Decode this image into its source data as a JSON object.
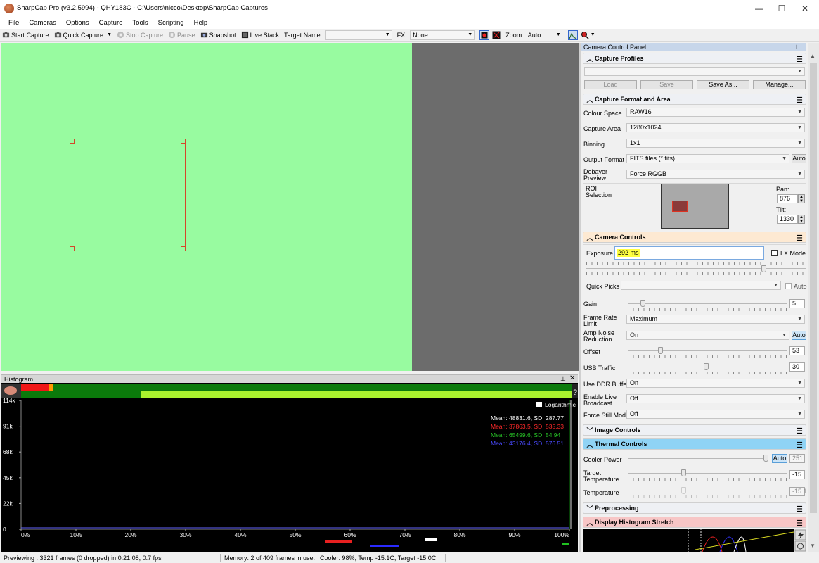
{
  "window": {
    "title": "SharpCap Pro (v3.2.5994) - QHY183C - C:\\Users\\nicco\\Desktop\\SharpCap Captures",
    "minimize": "—",
    "maximize": "☐",
    "close": "✕"
  },
  "menu": [
    "File",
    "Cameras",
    "Options",
    "Capture",
    "Tools",
    "Scripting",
    "Help"
  ],
  "toolbar": {
    "start_capture": "Start Capture",
    "quick_capture": "Quick Capture",
    "stop_capture": "Stop Capture",
    "pause": "Pause",
    "snapshot": "Snapshot",
    "live_stack": "Live Stack",
    "target_name_label": "Target Name :",
    "target_name_value": "",
    "fx_label": "FX :",
    "fx_value": "None",
    "zoom_label": "Zoom:",
    "zoom_value": "Auto"
  },
  "histogram": {
    "title": "Histogram",
    "logarithmic_label": "Logarithmic",
    "help": "?",
    "y_ticks": [
      "114k",
      "91k",
      "68k",
      "45k",
      "22k",
      "0"
    ],
    "x_ticks": [
      "0%",
      "10%",
      "20%",
      "30%",
      "40%",
      "50%",
      "60%",
      "70%",
      "80%",
      "90%",
      "100%"
    ],
    "stats": [
      {
        "text": "Mean: 48831.6, SD: 287.77",
        "color": "#ffffff"
      },
      {
        "text": "Mean: 37863.5, SD: 535.33",
        "color": "#ff2a2a"
      },
      {
        "text": "Mean: 65499.6, SD: 54.94",
        "color": "#27c227"
      },
      {
        "text": "Mean: 43176.4, SD: 576.51",
        "color": "#4a4aff"
      }
    ]
  },
  "status": {
    "previewing": "Previewing : 3321 frames (0 dropped) in 0:21:08, 0.7 fps",
    "memory": "Memory: 2 of 409 frames in use.",
    "cooler": "Cooler: 98%, Temp -15.1C, Target -15.0C"
  },
  "panel": {
    "title": "Camera Control Panel",
    "capture_profiles": {
      "header": "Capture Profiles",
      "profile_value": "",
      "load": "Load",
      "save": "Save",
      "save_as": "Save As...",
      "manage": "Manage..."
    },
    "capture_format": {
      "header": "Capture Format and Area",
      "colour_space_label": "Colour Space",
      "colour_space": "RAW16",
      "capture_area_label": "Capture Area",
      "capture_area": "1280x1024",
      "binning_label": "Binning",
      "binning": "1x1",
      "output_format_label": "Output Format",
      "output_format": "FITS files (*.fits)",
      "output_auto": "Auto",
      "debayer_label_1": "Debayer",
      "debayer_label_2": "Preview",
      "debayer": "Force RGGB",
      "roi_label_1": "ROI",
      "roi_label_2": "Selection",
      "pan_label": "Pan:",
      "pan": "876",
      "tilt_label": "Tilt:",
      "tilt": "1330"
    },
    "camera_controls": {
      "header": "Camera Controls",
      "exposure_label": "Exposure",
      "exposure_value": "292 ms",
      "lx_mode": "LX Mode",
      "quick_picks_label": "Quick Picks",
      "quick_picks_value": "",
      "auto_label": "Auto",
      "gain_label": "Gain",
      "gain": "5",
      "gain_fraction": 0.09,
      "frame_rate_label_1": "Frame Rate",
      "frame_rate_label_2": "Limit",
      "frame_rate": "Maximum",
      "amp_noise_label_1": "Amp Noise",
      "amp_noise_label_2": "Reduction",
      "amp_noise": "On",
      "amp_noise_auto": "Auto",
      "offset_label": "Offset",
      "offset": "53",
      "usb_traffic_label": "USB Traffic",
      "usb_traffic": "30",
      "ddr_label": "Use DDR Buffer",
      "ddr": "On",
      "live_broadcast_label_1": "Enable Live",
      "live_broadcast_label_2": "Broadcast",
      "live_broadcast": "Off",
      "force_still_label": "Force Still Mode",
      "force_still": "Off"
    },
    "image_controls": {
      "header": "Image Controls"
    },
    "thermal_controls": {
      "header": "Thermal Controls",
      "cooler_power_label": "Cooler Power",
      "cooler_auto": "Auto",
      "cooler_power": "251",
      "target_temp_label_1": "Target",
      "target_temp_label_2": "Temperature",
      "target_temp": "-15",
      "temperature_label": "Temperature",
      "temperature": "-15.1"
    },
    "preprocessing": {
      "header": "Preprocessing"
    },
    "display_stretch": {
      "header": "Display Histogram Stretch"
    }
  },
  "colors": {
    "preview_green": "#98fba0",
    "roi_red": "#d3462a",
    "camera_controls_header": "#fde9d2",
    "thermal_header": "#8fd3f5",
    "display_stretch_header": "#f7c6c6",
    "highlight_yellow": "#ffff40"
  }
}
